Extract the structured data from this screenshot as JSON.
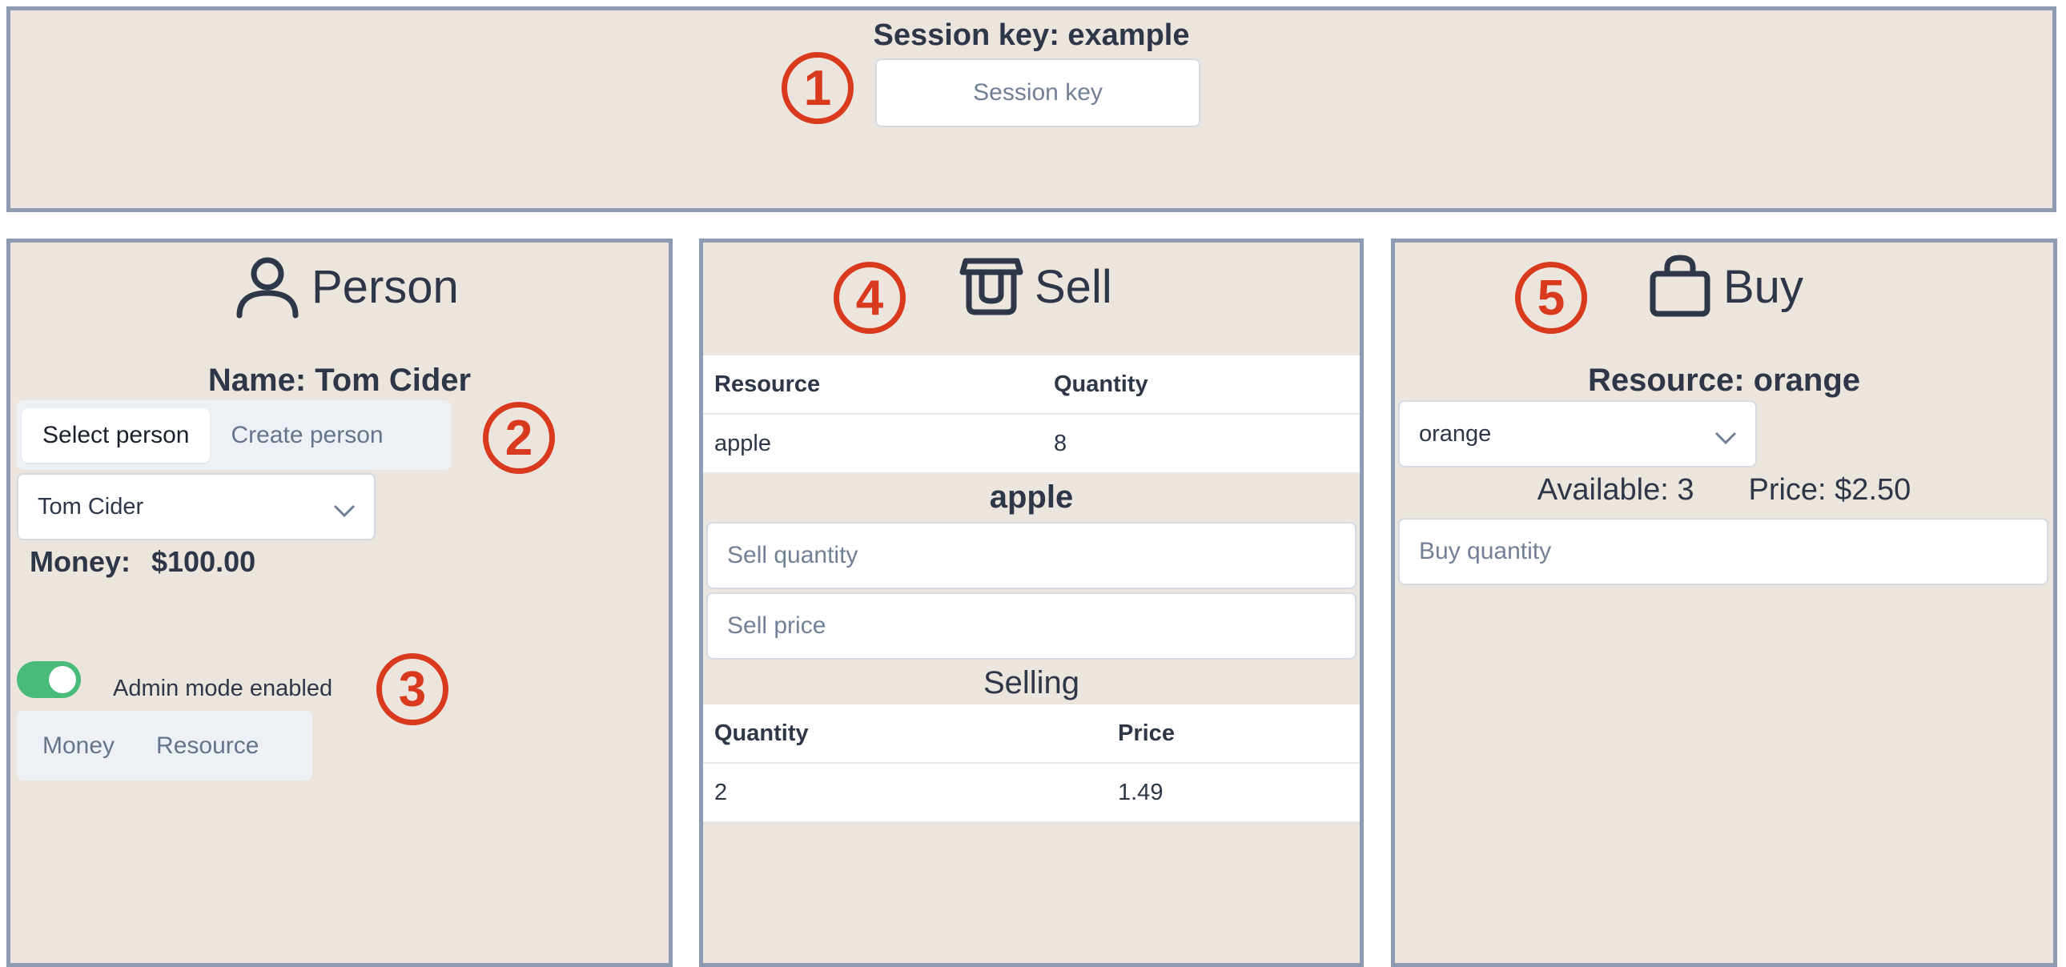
{
  "session": {
    "heading": "Session key: example",
    "input_placeholder": "Session key"
  },
  "person": {
    "title": "Person",
    "name_heading": "Name: Tom Cider",
    "tabs": [
      "Select person",
      "Create person"
    ],
    "selected_person": "Tom Cider",
    "money_label": "Money:",
    "money_value": "$100.00",
    "admin_label": "Admin mode enabled",
    "admin_enabled": true,
    "admin_tabs": [
      "Money",
      "Resource"
    ]
  },
  "sell": {
    "title": "Sell",
    "inventory_headers": [
      "Resource",
      "Quantity"
    ],
    "inventory_rows": [
      [
        "apple",
        "8"
      ]
    ],
    "selected_resource": "apple",
    "quantity_placeholder": "Sell quantity",
    "price_placeholder": "Sell price",
    "selling_heading": "Selling",
    "selling_headers": [
      "Quantity",
      "Price"
    ],
    "selling_rows": [
      [
        "2",
        "1.49"
      ]
    ]
  },
  "buy": {
    "title": "Buy",
    "resource_heading": "Resource: orange",
    "selected_resource": "orange",
    "available": "Available: 3",
    "price": "Price: $2.50",
    "quantity_placeholder": "Buy quantity"
  },
  "markers": [
    "1",
    "2",
    "3",
    "4",
    "5"
  ],
  "colors": {
    "panel_bg": "#ebe5de",
    "panel_border": "#8f9bb3",
    "marker_red": "#d9391c",
    "toggle_green": "#48bb78"
  }
}
